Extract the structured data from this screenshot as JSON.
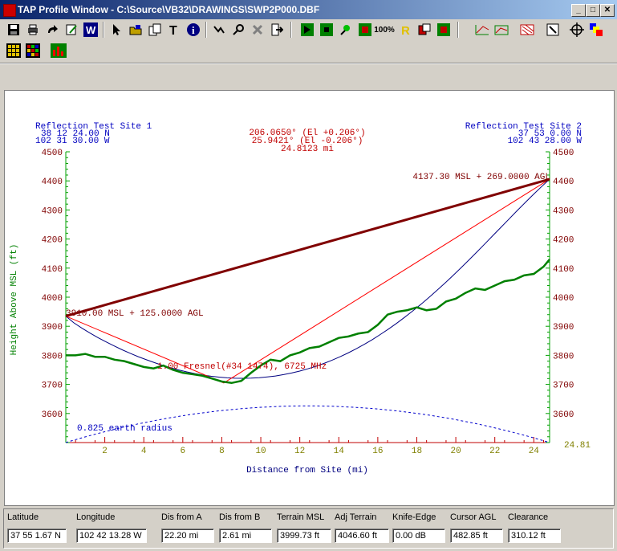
{
  "window": {
    "title": "TAP Profile Window - C:\\Source\\VB32\\DRAWINGS\\SWP2P000.DBF",
    "buttons": [
      "_",
      "□",
      "✕"
    ]
  },
  "toolbar": {
    "row1": [
      "save-icon",
      "print-icon",
      "redo-icon",
      "edit-icon",
      "w-icon",
      "pointer-icon",
      "open-icon",
      "copy-icon",
      "text-icon",
      "info-icon",
      "route-icon",
      "zoom-icon",
      "delete-icon",
      "exit-icon",
      "path-icon",
      "site-icon",
      "pin-icon",
      "stop-icon",
      "zoom100-icon",
      "r-icon",
      "map-icon",
      "grid-icon",
      "slope-icon",
      "area-icon",
      "hatch-icon",
      "measure-icon",
      "crosshair-icon",
      "layers-icon"
    ],
    "row2": [
      "table-icon",
      "color-grid-icon",
      "histogram-icon"
    ]
  },
  "chart_data": {
    "type": "line",
    "site_a": {
      "name": "Reflection Test Site 1",
      "lat": "38 12 24.00 N",
      "lon": "102 31 30.00 W"
    },
    "site_b": {
      "name": "Reflection Test Site 2",
      "lat": "37 53 0.00 N",
      "lon": "102 43 28.00 W"
    },
    "path_info": [
      "206.0650° (El +0.206°)",
      "25.9421° (El -0.206°)",
      "24.8123 mi"
    ],
    "xlabel": "Distance from Site (mi)",
    "ylabel": "Height Above MSL (ft)",
    "xlim": [
      0,
      24.81
    ],
    "ylim": [
      3500,
      4500
    ],
    "x_ticks": [
      "2",
      "4",
      "6",
      "8",
      "10",
      "12",
      "14",
      "16",
      "18",
      "20",
      "22",
      "24"
    ],
    "x_end_label": "24.81",
    "y_ticks": [
      "3600",
      "3700",
      "3800",
      "3900",
      "4000",
      "4100",
      "4200",
      "4300",
      "4400",
      "4500"
    ],
    "annotations": {
      "site_a_height": "3910.00 MSL + 125.0000 AGL",
      "site_b_height": "4137.30 MSL + 269.0000 AGL",
      "fresnel": "1.00 Fresnel(#34 1474), 6725 MHz",
      "earth_radius": "0.825 earth radius"
    },
    "series": [
      {
        "name": "terrain",
        "color": "#008000",
        "x": [
          0,
          0.5,
          1,
          1.5,
          2,
          2.5,
          3,
          3.5,
          4,
          4.5,
          5,
          5.5,
          6,
          6.5,
          7,
          7.5,
          8,
          8.5,
          9,
          9.5,
          10,
          10.5,
          11,
          11.5,
          12,
          12.5,
          13,
          13.5,
          14,
          14.5,
          15,
          15.5,
          16,
          16.5,
          17,
          17.5,
          18,
          18.5,
          19,
          19.5,
          20,
          20.5,
          21,
          21.5,
          22,
          22.5,
          23,
          23.5,
          24,
          24.5,
          24.81
        ],
        "y": [
          3800,
          3800,
          3805,
          3795,
          3795,
          3785,
          3780,
          3770,
          3760,
          3755,
          3765,
          3750,
          3740,
          3735,
          3730,
          3720,
          3710,
          3705,
          3712,
          3740,
          3765,
          3785,
          3780,
          3800,
          3810,
          3825,
          3830,
          3845,
          3860,
          3865,
          3875,
          3880,
          3905,
          3940,
          3950,
          3955,
          3965,
          3955,
          3960,
          3985,
          3995,
          4015,
          4030,
          4025,
          4040,
          4055,
          4060,
          4075,
          4080,
          4105,
          4130
        ]
      },
      {
        "name": "direct path",
        "color": "#800000",
        "x": [
          0,
          24.81
        ],
        "y": [
          3935,
          4406
        ]
      },
      {
        "name": "reflection path",
        "color": "#ff0000",
        "x": [
          0,
          8.1,
          24.81
        ],
        "y": [
          3935,
          3705,
          4406
        ]
      },
      {
        "name": "fresnel/earth curve",
        "color": "#000080",
        "type": "curve"
      },
      {
        "name": "earth bulge",
        "color": "#0000cc",
        "dashed": true
      }
    ]
  },
  "status": {
    "fields": [
      {
        "label": "Latitude",
        "value": "37 55 1.67 N"
      },
      {
        "label": "Longitude",
        "value": "102 42 13.28 W"
      },
      {
        "label": "Dis from A",
        "value": "22.20 mi"
      },
      {
        "label": "Dis from B",
        "value": "2.61 mi"
      },
      {
        "label": "Terrain MSL",
        "value": "3999.73 ft"
      },
      {
        "label": "Adj Terrain",
        "value": "4046.60 ft"
      },
      {
        "label": "Knife-Edge",
        "value": "0.00 dB"
      },
      {
        "label": "Cursor AGL",
        "value": "482.85 ft"
      },
      {
        "label": "Clearance",
        "value": "310.12 ft"
      }
    ]
  }
}
